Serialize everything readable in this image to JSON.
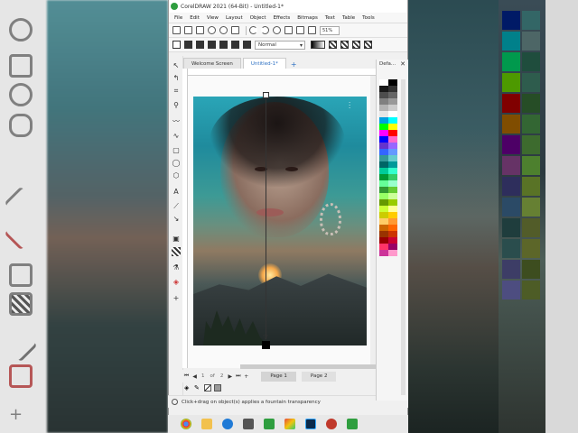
{
  "window": {
    "title": "CorelDRAW 2021 (64-Bit) - Untitled-1*"
  },
  "menu": [
    "File",
    "Edit",
    "View",
    "Layout",
    "Object",
    "Effects",
    "Bitmaps",
    "Text",
    "Table",
    "Tools"
  ],
  "toolbar": {
    "zoom": "51%",
    "transparency_mode": "Normal"
  },
  "tabs": {
    "welcome": "Welcome Screen",
    "document": "Untitled-1*",
    "add": "+"
  },
  "page_nav": {
    "current": "1",
    "of_label": "of",
    "total": "2",
    "page1": "Page 1",
    "page2": "Page 2"
  },
  "status": {
    "hint": "Click+drag on object(s) applies a fountain transparency"
  },
  "palette_docker": {
    "title": "Defa..."
  },
  "colors": {
    "accent": "#2b6fc2",
    "app_logo": "#2f9e3f"
  },
  "palette_swatches": [
    "#ffffff",
    "#000000",
    "#1a1a1a",
    "#333333",
    "#4d4d4d",
    "#666666",
    "#808080",
    "#999999",
    "#b3b3b3",
    "#cccccc",
    "#e6e6e6",
    "#ffffff",
    "#00a0e0",
    "#00ffff",
    "#00ff00",
    "#ffff00",
    "#ff00ff",
    "#ff0000",
    "#0000ff",
    "#ff66cc",
    "#6633cc",
    "#9966ff",
    "#3366ff",
    "#6699ff",
    "#339999",
    "#66cccc",
    "#006666",
    "#009999",
    "#00cc99",
    "#33ffcc",
    "#009933",
    "#33cc66",
    "#66ff99",
    "#99ffcc",
    "#339933",
    "#66cc33",
    "#99ff66",
    "#ccff99",
    "#669900",
    "#99cc00",
    "#ccff33",
    "#ffff99",
    "#cccc00",
    "#ffcc00",
    "#ffcc66",
    "#ff9933",
    "#cc6600",
    "#ff6600",
    "#993300",
    "#cc3300",
    "#990000",
    "#cc0033",
    "#ff3366",
    "#990066",
    "#cc3399",
    "#ff99cc"
  ],
  "bg_swatches": [
    "#001a66",
    "#00808a",
    "#00994d",
    "#4d9900",
    "#800000",
    "#804d00",
    "#4d0066",
    "#663366",
    "#2e2e5c",
    "#2b4a66",
    "#1f3d3d",
    "#2a4d4d",
    "#3d3d66",
    "#4d4d80",
    "#336666",
    "#4d6666",
    "#1f4d3d",
    "#2e5c4d",
    "#264d26",
    "#336633",
    "#3d6b2e",
    "#4d802e",
    "#597326",
    "#668033",
    "#525c29",
    "#5c6629",
    "#3d4d1f",
    "#4d5c26"
  ]
}
